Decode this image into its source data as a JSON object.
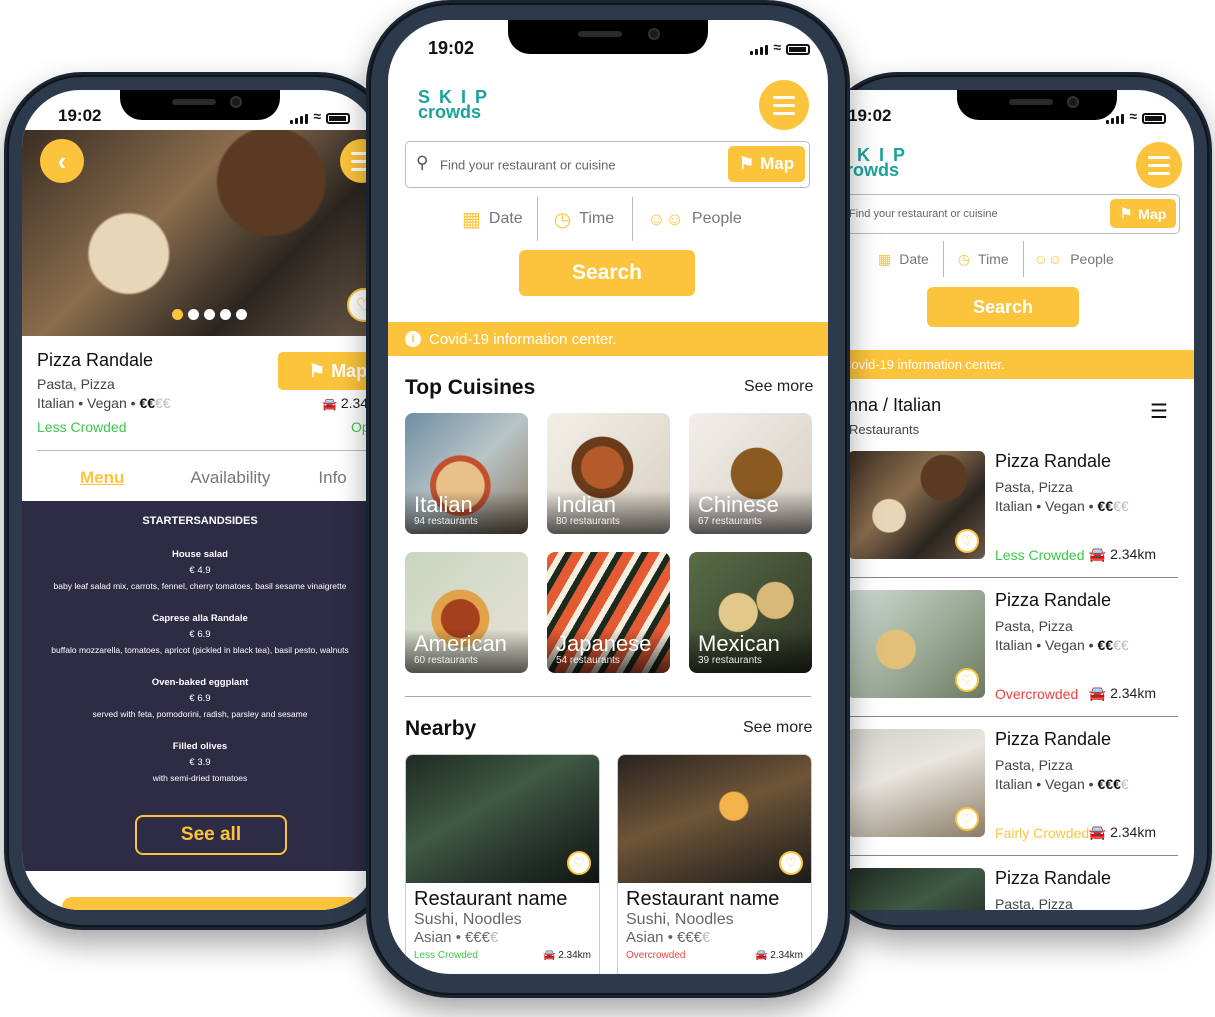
{
  "colors": {
    "accent": "#fcc43c",
    "brand": "#1aa399",
    "less_crowded": "#3cc84a",
    "overcrowded": "#f23e3e",
    "fairly_crowded": "#fcc43c",
    "menu_bg": "#2e2b45"
  },
  "status_time": "19:02",
  "logo": {
    "line1": "SKIP",
    "line2": "crowds"
  },
  "search": {
    "placeholder": "Find your restaurant or cuisine",
    "map_label": "Map",
    "search_label": "Search"
  },
  "filters": {
    "date": "Date",
    "time": "Time",
    "people": "People"
  },
  "covid": "Covid-19 information center.",
  "detail": {
    "name": "Pizza Randale",
    "cuisine": "Pasta, Pizza",
    "tags": "Italian • Vegan •",
    "price_on": "€€",
    "price_off": "€€",
    "crowd": "Less Crowded",
    "map_label": "Map",
    "distance": "2.34",
    "open_status": "Op",
    "tabs": [
      "Menu",
      "Availability",
      "Info"
    ],
    "menu_section": "STARTERSANDSIDES",
    "menu_items": [
      {
        "name": "House salad",
        "price": "€ 4.9",
        "desc": "baby leaf salad mix, carrots, fennel, cherry tomatoes, basil sesame vinaigrette"
      },
      {
        "name": "Caprese alla Randale",
        "price": "€ 6.9",
        "desc": "buffalo mozzarella, tomatoes, apricot (pickled in black tea), basil pesto, walnuts"
      },
      {
        "name": "Oven-baked eggplant",
        "price": "€ 6.9",
        "desc": "served with feta, pomodorini, radish, parsley and sesame"
      },
      {
        "name": "Filled olives",
        "price": "€ 3.9",
        "desc": "with semi-dried tomatoes"
      }
    ],
    "see_all": "See all",
    "carousel_dots": 5,
    "carousel_active": 1
  },
  "home": {
    "top_cuisines": "Top Cuisines",
    "see_more": "See more",
    "cuisines": [
      {
        "name": "Italian",
        "count": "94 restaurants"
      },
      {
        "name": "Indian",
        "count": "80 restaurants"
      },
      {
        "name": "Chinese",
        "count": "67 restaurants"
      },
      {
        "name": "American",
        "count": "60 restaurants"
      },
      {
        "name": "Japanese",
        "count": "54 restaurants"
      },
      {
        "name": "Mexican",
        "count": "39 restaurants"
      }
    ],
    "nearby": "Nearby",
    "nearby_items": [
      {
        "name": "Restaurant name",
        "cuisine": "Sushi, Noodles",
        "tags": "Asian  •",
        "price_on": "€€€",
        "price_off": "€",
        "crowd": "Less Crowded",
        "distance": "2.34km"
      },
      {
        "name": "Restaurant name",
        "cuisine": "Sushi, Noodles",
        "tags": "Asian  •",
        "price_on": "€€€",
        "price_off": "€",
        "crowd": "Overcrowded",
        "distance": "2.34km"
      }
    ]
  },
  "list": {
    "heading": "enna / Italian",
    "subheading": "Restaurants",
    "items": [
      {
        "name": "Pizza Randale",
        "cuisine": "Pasta, Pizza",
        "tags": "Italian • Vegan •",
        "price_on": "€€",
        "price_off": "€€",
        "crowd": "Less Crowded",
        "distance": "2.34km"
      },
      {
        "name": "Pizza Randale",
        "cuisine": "Pasta, Pizza",
        "tags": "Italian • Vegan •",
        "price_on": "€€",
        "price_off": "€€",
        "crowd": "Overcrowded",
        "distance": "2.34km"
      },
      {
        "name": "Pizza Randale",
        "cuisine": "Pasta, Pizza",
        "tags": "Italian • Vegan •",
        "price_on": "€€€",
        "price_off": "€",
        "crowd": "Fairly Crowded",
        "distance": "2.34km"
      },
      {
        "name": "Pizza Randale",
        "cuisine": "Pasta, Pizza"
      }
    ]
  }
}
